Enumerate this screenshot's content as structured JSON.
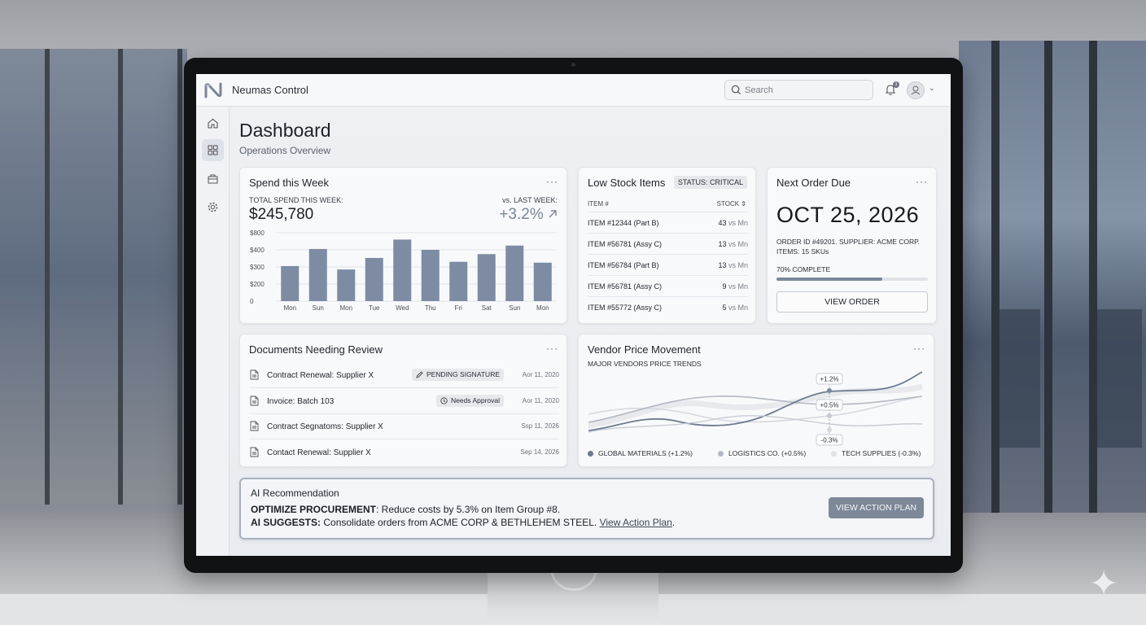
{
  "app": {
    "title": "Neumas Control"
  },
  "search": {
    "placeholder": "Search"
  },
  "notifications": {
    "count": "1"
  },
  "page": {
    "title": "Dashboard",
    "subtitle": "Operations Overview"
  },
  "spend": {
    "title": "Spend this Week",
    "total_label": "TOTAL SPEND THIS WEEK:",
    "total_value": "$245,780",
    "vs_label": "vs. LAST WEEK:",
    "vs_value": "+3.2%",
    "more": "···"
  },
  "chart_data": {
    "type": "bar",
    "categories": [
      "Mon",
      "Sun",
      "Mon",
      "Tue",
      "Wed",
      "Thu",
      "Fri",
      "Sat",
      "Sun",
      "Mon"
    ],
    "values": [
      410,
      610,
      370,
      505,
      720,
      600,
      460,
      550,
      650,
      450
    ],
    "ylim": [
      0,
      800
    ],
    "yticks": [
      "0",
      "$200",
      "$300",
      "$400",
      "$800"
    ],
    "grid": true,
    "bar_color": "#7d8ba3"
  },
  "low_stock": {
    "title": "Low Stock Items",
    "status": "STATUS: CRITICAL",
    "col_item": "ITEM #",
    "col_stock": "STOCK ⇕",
    "rows": [
      {
        "item": "ITEM #12344 (Part B)",
        "qty": "43",
        "vs": "vs Mn"
      },
      {
        "item": "ITEM #56781 (Assy C)",
        "qty": "13",
        "vs": "vs Mn"
      },
      {
        "item": "ITEM #56784 (Part B)",
        "qty": "13",
        "vs": "vs Mn"
      },
      {
        "item": "ITEM #56781 (Assy C)",
        "qty": "9",
        "vs": "vs Mn"
      },
      {
        "item": "ITEM #55772 (Assy C)",
        "qty": "5",
        "vs": "vs Mn"
      }
    ]
  },
  "next_order": {
    "title": "Next Order Due",
    "date": "OCT 25, 2026",
    "meta_line1": "ORDER ID #49201. SUPPLIER: ACME CORP.",
    "meta_line2": "ITEMS: 15 SKUs",
    "progress_label": "70% COMPLETE",
    "progress": 0.7,
    "button": "VIEW ORDER"
  },
  "documents": {
    "title": "Documents Needing Review",
    "rows": [
      {
        "name": "Contract Renewal: Supplier X",
        "badge": "PENDING SIGNATURE",
        "date": "Aor 11, 2020"
      },
      {
        "name": "Invoice: Batch 103",
        "badge": "Needs Approval",
        "date": "Aor 11, 2020"
      },
      {
        "name": "Contract Segnatoms: Supplier X",
        "badge": "",
        "date": "Ssp 11, 2026"
      },
      {
        "name": "Contact Renewal: Supplier X",
        "badge": "",
        "date": "Sep 14, 2026"
      }
    ]
  },
  "vendor": {
    "title": "Vendor Price Movement",
    "subtitle": "MAJOR VENDORS PRICE TRENDS",
    "callouts": [
      "+1.2%",
      "+0.5%",
      "-0.3%"
    ],
    "legend": [
      {
        "name": "GLOBAL MATERIALS (+1.2%)",
        "color": "#6d7a90"
      },
      {
        "name": "LOGISTICS CO. (+0.5%)",
        "color": "#b3b9c3"
      },
      {
        "name": "TECH SUPPLIES (-0.3%)",
        "color": "#dfe2e7"
      }
    ]
  },
  "ai": {
    "title": "AI Recommendation",
    "line1_bold": "OPTIMIZE PROCUREMENT",
    "line1_rest": ": Reduce costs by 5.3% on Item Group #8.",
    "line2_bold": "AI SUGGESTS:",
    "line2_rest": " Consolidate orders from ACME CORP & BETHLEHEM STEEL. ",
    "line2_link": "View Action Plan",
    "line2_end": ".",
    "button": "VIEW ACTION PLAN"
  }
}
